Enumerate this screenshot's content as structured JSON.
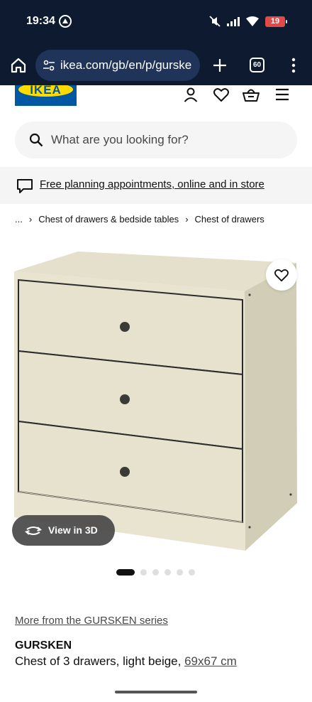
{
  "status_bar": {
    "time": "19:34",
    "battery": "19",
    "icons": [
      "pin-icon",
      "mute-icon",
      "signal-icon",
      "wifi-icon",
      "battery-icon"
    ]
  },
  "browser": {
    "url": "ikea.com/gb/en/p/gurske",
    "tab_count": "60"
  },
  "header": {
    "logo_text": "IKEA",
    "icons": [
      "account-icon",
      "heart-icon",
      "basket-icon",
      "menu-icon"
    ],
    "brand_blue": "#0058a3",
    "brand_yellow": "#ffdb00"
  },
  "search": {
    "placeholder": "What are you looking for?"
  },
  "banner": {
    "text": "Free planning appointments, online and in store"
  },
  "breadcrumb": {
    "items": [
      "...",
      "Chest of drawers & bedside tables",
      "Chest of drawers"
    ]
  },
  "gallery": {
    "view_3d_label": "View in 3D",
    "image_count": 6,
    "active_index": 0
  },
  "product": {
    "series_link": "More from the GURSKEN series",
    "name": "GURSKEN",
    "description": "Chest of 3 drawers, light beige,",
    "size": "69x67 cm"
  }
}
